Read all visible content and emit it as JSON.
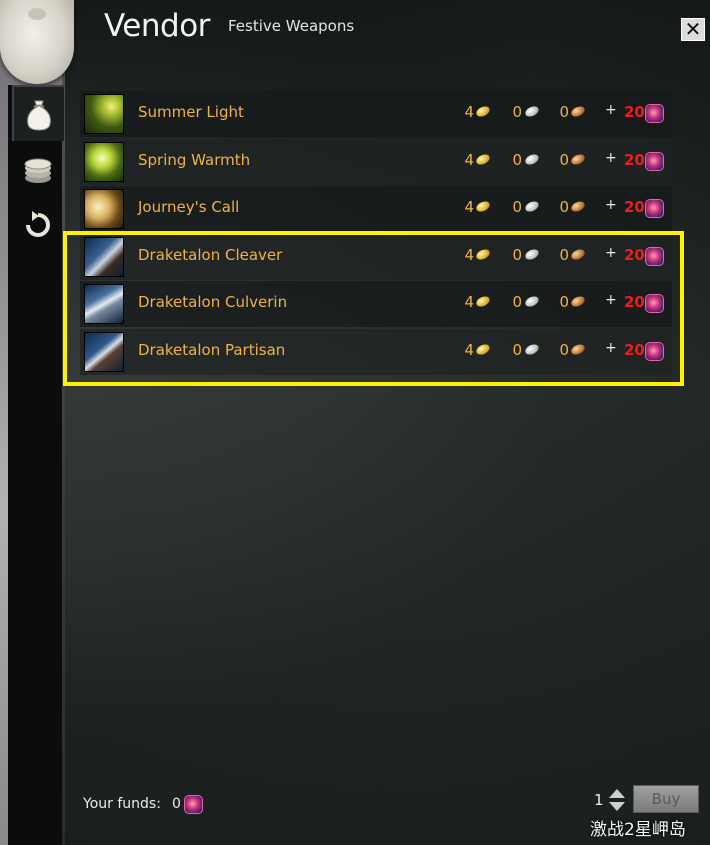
{
  "window": {
    "title": "Vendor",
    "subtitle": "Festive Weapons",
    "close_label": "✕"
  },
  "tabs": [
    {
      "name": "buy-tab",
      "icon": "sack-icon",
      "active": true
    },
    {
      "name": "sell-tab",
      "icon": "coins-icon",
      "active": false
    },
    {
      "name": "buyback-tab",
      "icon": "undo-arrow-icon",
      "active": false
    }
  ],
  "items": [
    {
      "name": "Summer Light",
      "gold": "4",
      "silver": "0",
      "copper": "0",
      "plus": "+",
      "tokens": "20",
      "icon": "torch-weapon-icon"
    },
    {
      "name": "Spring Warmth",
      "gold": "4",
      "silver": "0",
      "copper": "0",
      "plus": "+",
      "tokens": "20",
      "icon": "staff-weapon-icon"
    },
    {
      "name": "Journey's Call",
      "gold": "4",
      "silver": "0",
      "copper": "0",
      "plus": "+",
      "tokens": "20",
      "icon": "horn-weapon-icon"
    },
    {
      "name": "Draketalon Cleaver",
      "gold": "4",
      "silver": "0",
      "copper": "0",
      "plus": "+",
      "tokens": "20",
      "icon": "axe-weapon-icon"
    },
    {
      "name": "Draketalon Culverin",
      "gold": "4",
      "silver": "0",
      "copper": "0",
      "plus": "+",
      "tokens": "20",
      "icon": "rifle-weapon-icon"
    },
    {
      "name": "Draketalon Partisan",
      "gold": "4",
      "silver": "0",
      "copper": "0",
      "plus": "+",
      "tokens": "20",
      "icon": "spear-weapon-icon"
    }
  ],
  "footer": {
    "funds_label": "Your funds:",
    "funds_value": "0",
    "quantity": "1",
    "buy_label": "Buy"
  },
  "watermark": "激战2星岬岛",
  "colors": {
    "item_name": "#f0b24a",
    "token_price": "#f01b1b",
    "highlight": "#fff200"
  }
}
